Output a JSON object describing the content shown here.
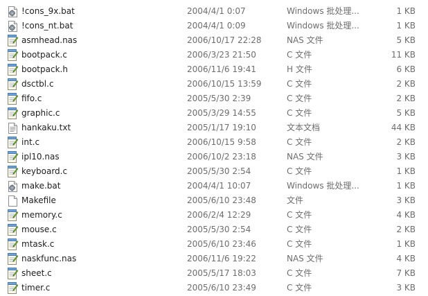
{
  "files": [
    {
      "name": "!cons_9x.bat",
      "modified": "2004/4/1 0:07",
      "type": "Windows 批处理...",
      "size": "1 KB",
      "icon": "batch-file-icon"
    },
    {
      "name": "!cons_nt.bat",
      "modified": "2004/4/1 0:09",
      "type": "Windows 批处理...",
      "size": "1 KB",
      "icon": "batch-file-icon"
    },
    {
      "name": "asmhead.nas",
      "modified": "2006/10/17 22:28",
      "type": "NAS 文件",
      "size": "5 KB",
      "icon": "notepad-file-icon"
    },
    {
      "name": "bootpack.c",
      "modified": "2006/3/23 21:50",
      "type": "C 文件",
      "size": "11 KB",
      "icon": "notepad-file-icon"
    },
    {
      "name": "bootpack.h",
      "modified": "2006/11/6 19:41",
      "type": "H 文件",
      "size": "6 KB",
      "icon": "notepad-file-icon"
    },
    {
      "name": "dsctbl.c",
      "modified": "2006/10/15 13:59",
      "type": "C 文件",
      "size": "2 KB",
      "icon": "notepad-file-icon"
    },
    {
      "name": "fifo.c",
      "modified": "2005/5/30 2:39",
      "type": "C 文件",
      "size": "2 KB",
      "icon": "notepad-file-icon"
    },
    {
      "name": "graphic.c",
      "modified": "2005/3/29 14:55",
      "type": "C 文件",
      "size": "5 KB",
      "icon": "notepad-file-icon"
    },
    {
      "name": "hankaku.txt",
      "modified": "2005/1/17 19:10",
      "type": "文本文档",
      "size": "44 KB",
      "icon": "text-document-icon"
    },
    {
      "name": "int.c",
      "modified": "2006/10/15 9:58",
      "type": "C 文件",
      "size": "2 KB",
      "icon": "notepad-file-icon"
    },
    {
      "name": "ipl10.nas",
      "modified": "2006/10/2 23:18",
      "type": "NAS 文件",
      "size": "3 KB",
      "icon": "notepad-file-icon"
    },
    {
      "name": "keyboard.c",
      "modified": "2005/5/30 2:54",
      "type": "C 文件",
      "size": "1 KB",
      "icon": "notepad-file-icon"
    },
    {
      "name": "make.bat",
      "modified": "2004/4/1 10:07",
      "type": "Windows 批处理...",
      "size": "1 KB",
      "icon": "batch-file-icon"
    },
    {
      "name": "Makefile",
      "modified": "2005/6/10 23:48",
      "type": "文件",
      "size": "3 KB",
      "icon": "blank-file-icon"
    },
    {
      "name": "memory.c",
      "modified": "2006/2/4 12:29",
      "type": "C 文件",
      "size": "4 KB",
      "icon": "notepad-file-icon"
    },
    {
      "name": "mouse.c",
      "modified": "2005/5/30 2:54",
      "type": "C 文件",
      "size": "2 KB",
      "icon": "notepad-file-icon"
    },
    {
      "name": "mtask.c",
      "modified": "2005/6/10 23:46",
      "type": "C 文件",
      "size": "1 KB",
      "icon": "notepad-file-icon"
    },
    {
      "name": "naskfunc.nas",
      "modified": "2006/11/6 19:22",
      "type": "NAS 文件",
      "size": "4 KB",
      "icon": "notepad-file-icon"
    },
    {
      "name": "sheet.c",
      "modified": "2005/5/17 18:03",
      "type": "C 文件",
      "size": "7 KB",
      "icon": "notepad-file-icon"
    },
    {
      "name": "timer.c",
      "modified": "2005/6/10 23:49",
      "type": "C 文件",
      "size": "3 KB",
      "icon": "notepad-file-icon"
    }
  ]
}
